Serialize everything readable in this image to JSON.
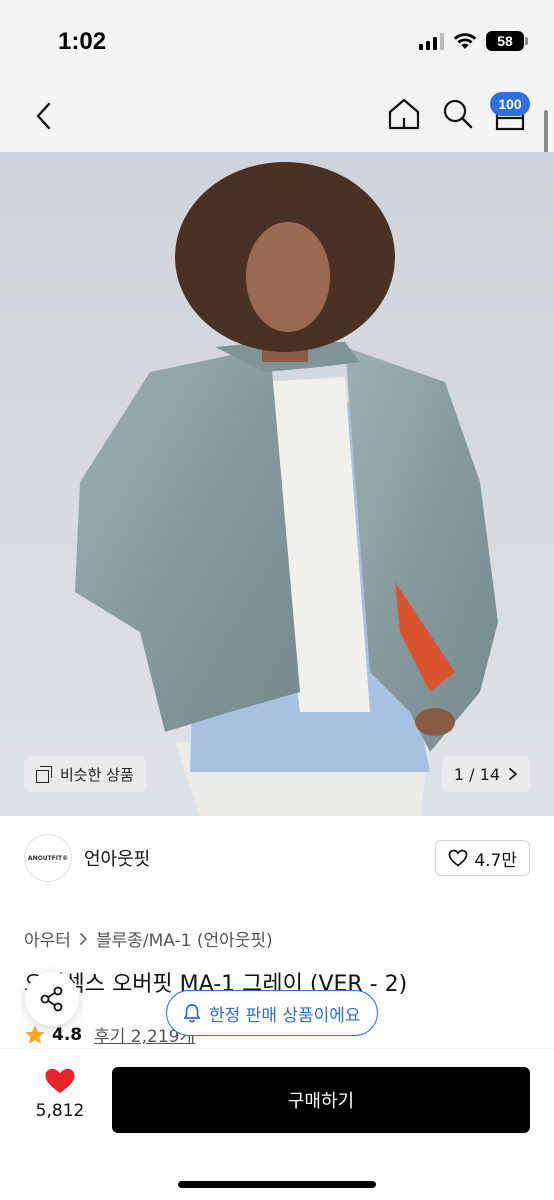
{
  "status_bar": {
    "time": "1:02",
    "battery": "58"
  },
  "nav": {
    "cart_count": "100"
  },
  "gallery": {
    "similar_label": "비슷한 상품",
    "counter": "1 / 14"
  },
  "brand": {
    "logo_text": "ANOUTFIT®",
    "name": "언아웃핏",
    "likes": "4.7만"
  },
  "product": {
    "category_parent": "아우터",
    "category_child": "블루종/MA-1 (언아웃핏)",
    "title": "오버섹스 오버핏 MA-1 그레이 (VER - 2)",
    "rating": "4.8",
    "reviews": "후기 2,219개"
  },
  "toast": {
    "label": "한정 판매 상품이에요"
  },
  "bottom": {
    "wish_count": "5,812",
    "buy_label": "구매하기"
  },
  "colors": {
    "accent": "#2f6fe0",
    "heart": "#e5242b",
    "star": "#f5a623"
  }
}
